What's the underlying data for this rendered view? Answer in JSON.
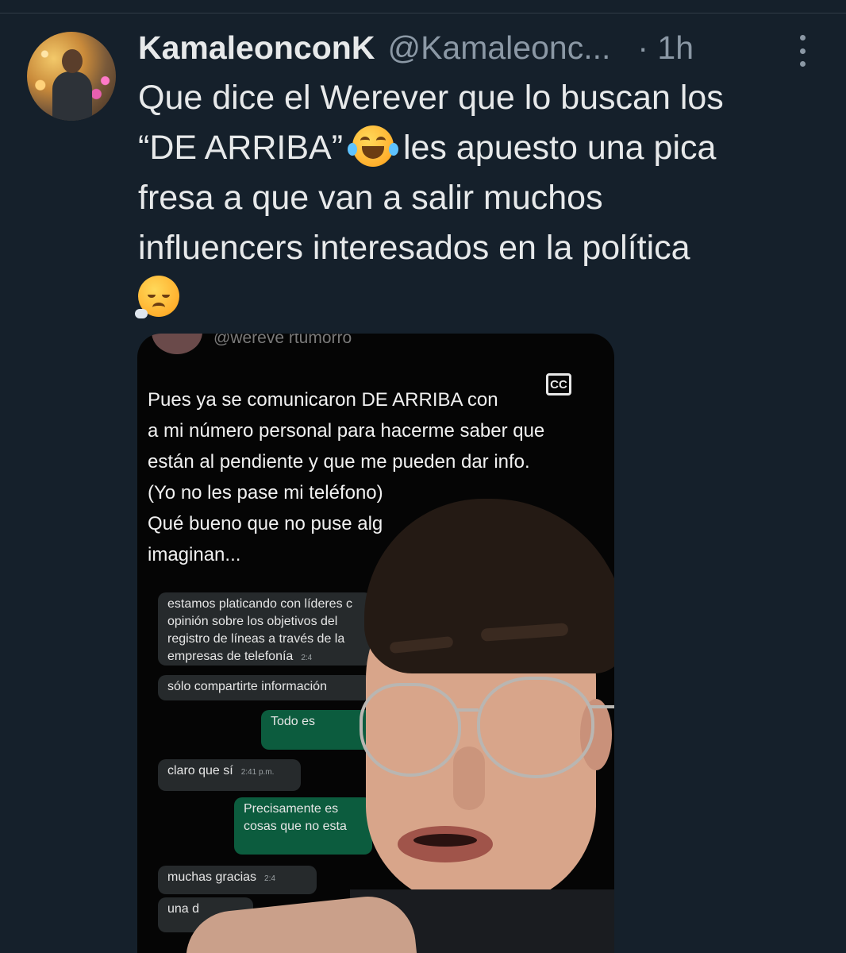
{
  "tweet": {
    "display_name": "KamaleonconK",
    "handle": "@Kamaleonc...",
    "time": "· 1h",
    "text_line1": "Que dice el Werever que lo buscan los",
    "text_line2a": "“DE ARRIBA”",
    "text_line2b": "les apuesto una pica",
    "text_line3": "fresa a que van a salir muchos",
    "text_line4": "influencers interesados en la política",
    "emoji_1": "face-with-tears-of-joy",
    "emoji_2": "face-exhaling"
  },
  "media": {
    "handle": "@wereve rtumorro",
    "cc_label": "CC",
    "caption_lines": [
      "Pues ya se comunicaron DE ARRIBA con",
      "a mi número personal para hacerme saber que",
      "están al pendiente y que me pueden dar info.",
      "(Yo no les pase mi teléfono)",
      "Qué bueno que no puse alg",
      "imaginan..."
    ],
    "chat": {
      "msg1_line1": "estamos platicando con líderes c",
      "msg1_line2": "opinión sobre los objetivos del",
      "msg1_line3": "registro de líneas a través de la",
      "msg1_line4": "empresas de telefonía",
      "msg1_time": "2:4",
      "msg2": "sólo compartirte información",
      "msg3": "Todo es",
      "msg4": "claro que sí",
      "msg4_time": "2:41 p.m.",
      "msg5_line1": "Precisamente es",
      "msg5_line2": "cosas que no esta",
      "msg6": "muchas gracias",
      "msg6_time": "2:4",
      "msg7": "una d"
    }
  },
  "colors": {
    "background": "#15202b",
    "primary_text": "#e7e9ea",
    "secondary_text": "#8b98a5",
    "chat_outgoing": "#0c5c3e",
    "chat_incoming": "#262a2c"
  }
}
